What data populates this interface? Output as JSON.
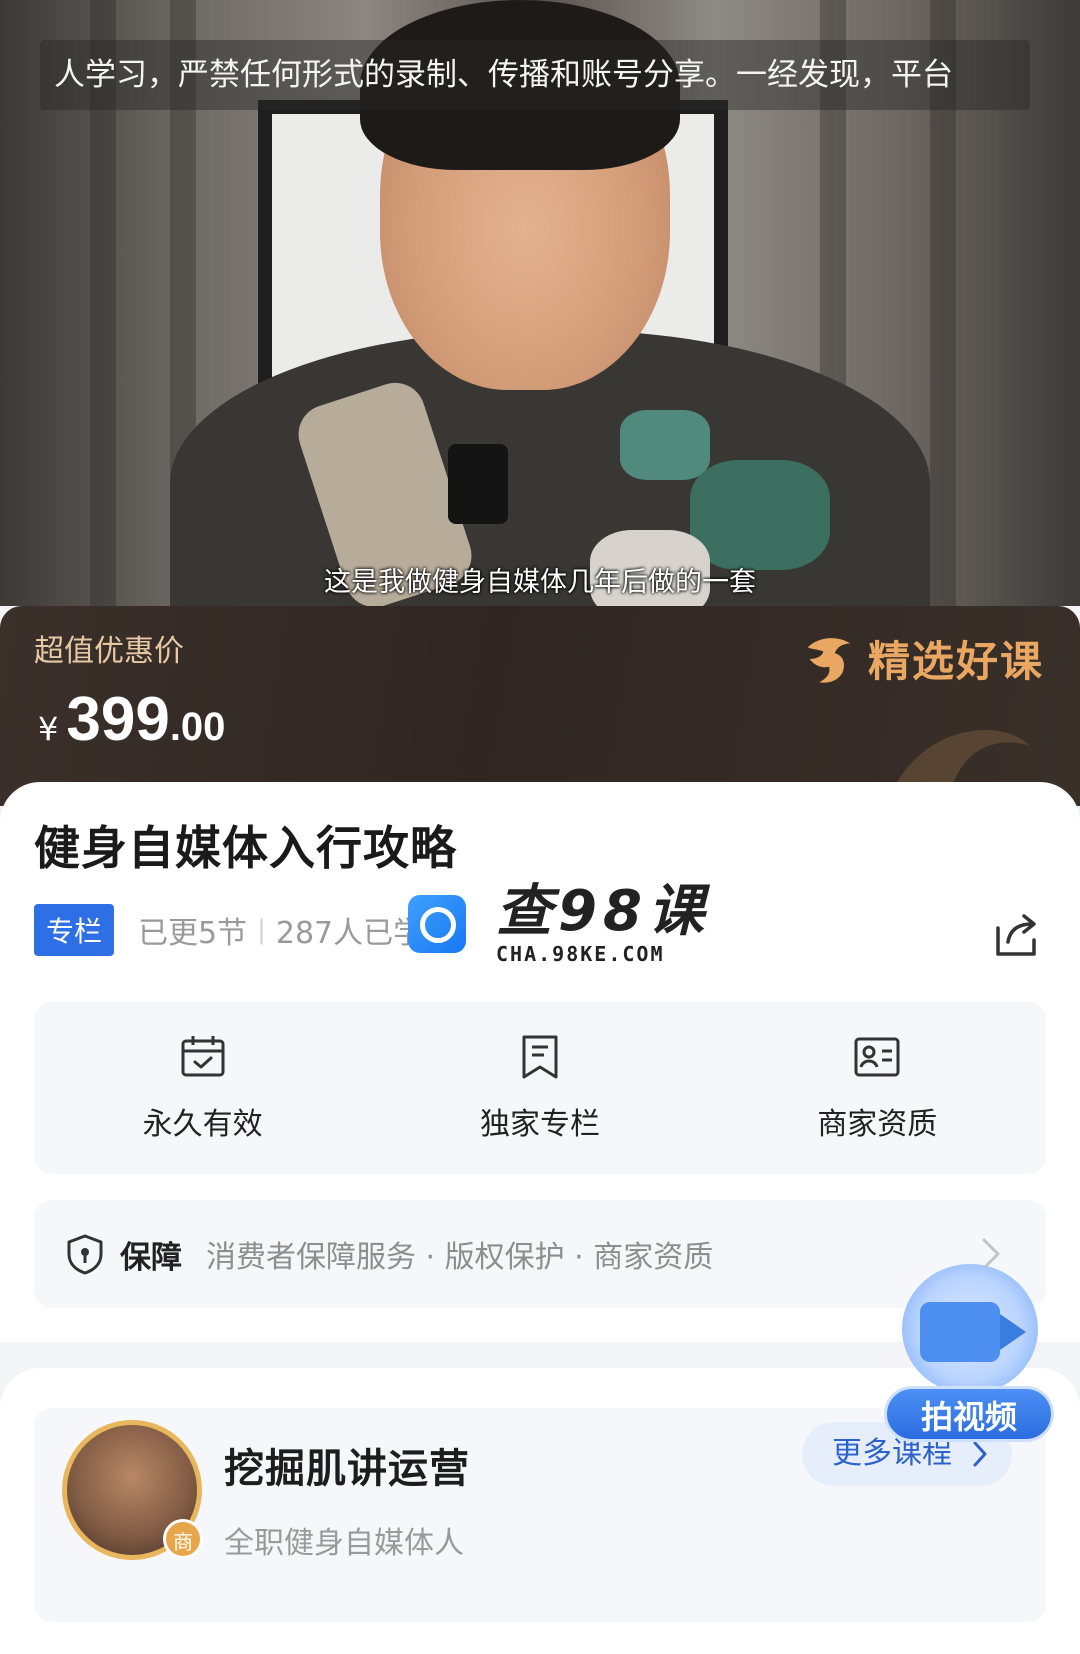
{
  "video": {
    "watermark": "人学习，严禁任何形式的录制、传播和账号分享。一经发现，平台",
    "subtitle": "这是我做健身自媒体几年后做的一套"
  },
  "price_banner": {
    "label": "超值优惠价",
    "currency": "¥",
    "price_integer": "399",
    "price_decimal": ".00",
    "badge_text": "精选好课"
  },
  "course": {
    "title": "健身自媒体入行攻略",
    "tag": "专栏",
    "updated": "已更5节",
    "separator": "|",
    "learners": "287人已学习"
  },
  "overlay_logo": {
    "brand": "查98课",
    "domain": "CHA.98KE.COM"
  },
  "features": [
    {
      "label": "永久有效",
      "icon": "calendar-check-icon"
    },
    {
      "label": "独家专栏",
      "icon": "bookmark-doc-icon"
    },
    {
      "label": "商家资质",
      "icon": "id-card-icon"
    }
  ],
  "guarantee": {
    "title": "保障",
    "items": "消费者保障服务 · 版权保护 · 商家资质"
  },
  "merchant": {
    "name": "挖掘肌讲运营",
    "description": "全职健身自媒体人",
    "badge": "商",
    "more_button": "更多课程"
  },
  "float_button": {
    "label": "拍视频"
  },
  "colors": {
    "accent_blue": "#2f6fe6",
    "price_gold": "#e6c9a4",
    "badge_orange": "#e9a761"
  }
}
